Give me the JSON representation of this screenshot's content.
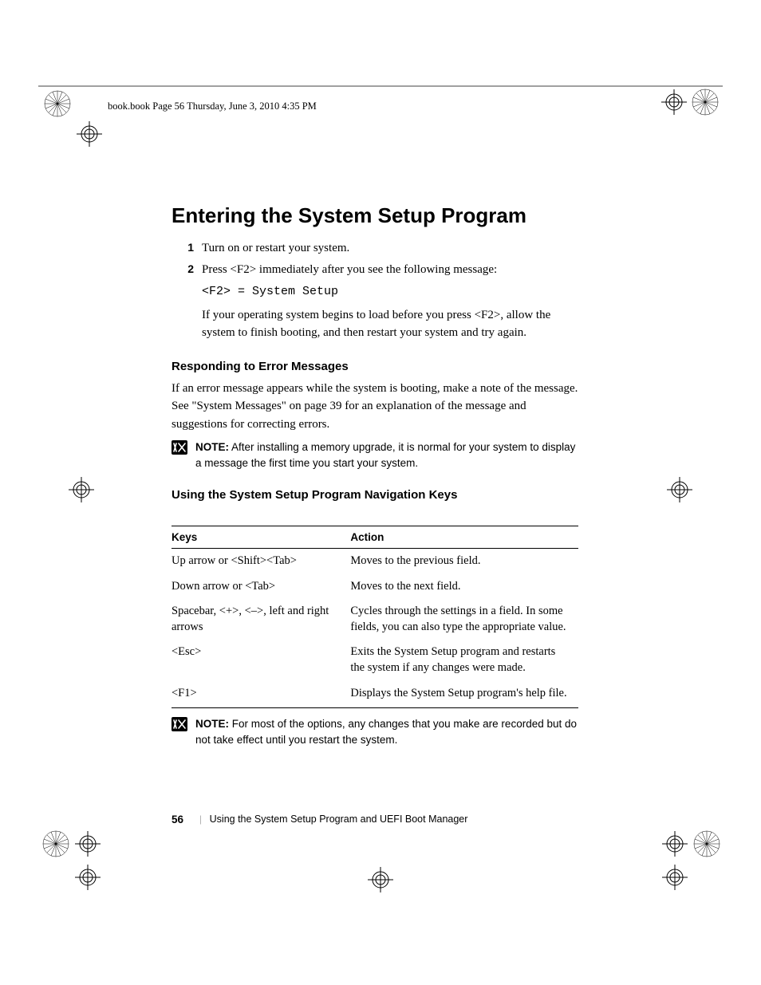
{
  "header_line": "book.book  Page 56  Thursday, June 3, 2010  4:35 PM",
  "h1": "Entering the System Setup Program",
  "steps": [
    {
      "num": "1",
      "text": "Turn on or restart your system."
    },
    {
      "num": "2",
      "text": "Press <F2> immediately after you see the following message:",
      "code": "<F2> = System Setup",
      "after": "If your operating system begins to load before you press <F2>, allow the system to finish booting, and then restart your system and try again."
    }
  ],
  "h2a": "Responding to Error Messages",
  "para_a": "If an error message appears while the system is booting, make a note of the message. See \"System Messages\" on page 39 for an explanation of the message and suggestions for correcting errors.",
  "note1_label": "NOTE:",
  "note1_text": " After installing a memory upgrade, it is normal for your system to display a message the first time you start your system.",
  "h2b": "Using the System Setup Program Navigation Keys",
  "table": {
    "head": [
      "Keys",
      "Action"
    ],
    "rows": [
      [
        "Up arrow or <Shift><Tab>",
        "Moves to the previous field."
      ],
      [
        "Down arrow or <Tab>",
        "Moves to the next field."
      ],
      [
        "Spacebar, <+>, <–>, left and right arrows",
        "Cycles through the settings in a field. In some fields, you can also type the appropriate value."
      ],
      [
        "<Esc>",
        "Exits the System Setup program and restarts the system if any changes were made."
      ],
      [
        "<F1>",
        "Displays the System Setup program's help file."
      ]
    ]
  },
  "note2_label": "NOTE:",
  "note2_text": " For most of the options, any changes that you make are recorded but do not take effect until you restart the system.",
  "footer": {
    "page": "56",
    "chapter": "Using the System Setup Program and UEFI Boot Manager"
  }
}
